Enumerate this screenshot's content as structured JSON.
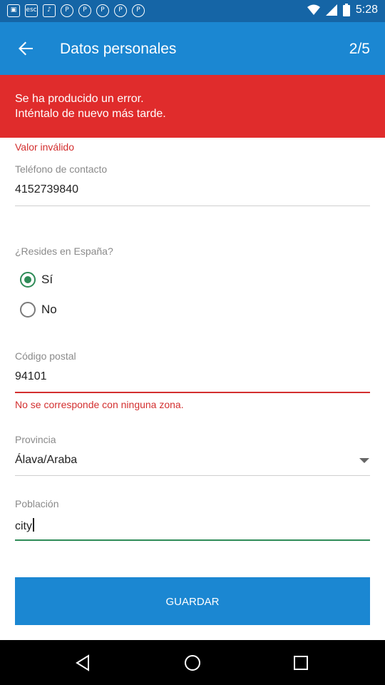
{
  "status_bar": {
    "time": "5:28",
    "icons": [
      "app-icon",
      "esc-icon",
      "music-icon",
      "pinterest-icon",
      "pinterest-icon",
      "pinterest-icon",
      "pinterest-icon",
      "pinterest-icon"
    ]
  },
  "app_bar": {
    "title": "Datos personales",
    "step": "2/5"
  },
  "error_banner": {
    "line1": "Se ha producido un error.",
    "line2": "Inténtalo de nuevo más tarde."
  },
  "form": {
    "phone": {
      "error": "Valor inválido",
      "label": "Teléfono de contacto",
      "value": "4152739840"
    },
    "resides": {
      "question": "¿Resides en España?",
      "options": [
        {
          "label": "Sí",
          "selected": true
        },
        {
          "label": "No",
          "selected": false
        }
      ]
    },
    "postal": {
      "label": "Código postal",
      "value": "94101",
      "error": "No se corresponde con ninguna zona."
    },
    "province": {
      "label": "Provincia",
      "value": "Álava/Araba"
    },
    "city": {
      "label": "Población",
      "value": "city"
    }
  },
  "save_button": {
    "label": "GUARDAR"
  },
  "colors": {
    "status_bar": "#1565a6",
    "app_bar": "#1b87d2",
    "error_banner": "#e02c2c",
    "error_text": "#d32f2f",
    "accent_green": "#2e8b57",
    "button": "#1b87d2"
  }
}
